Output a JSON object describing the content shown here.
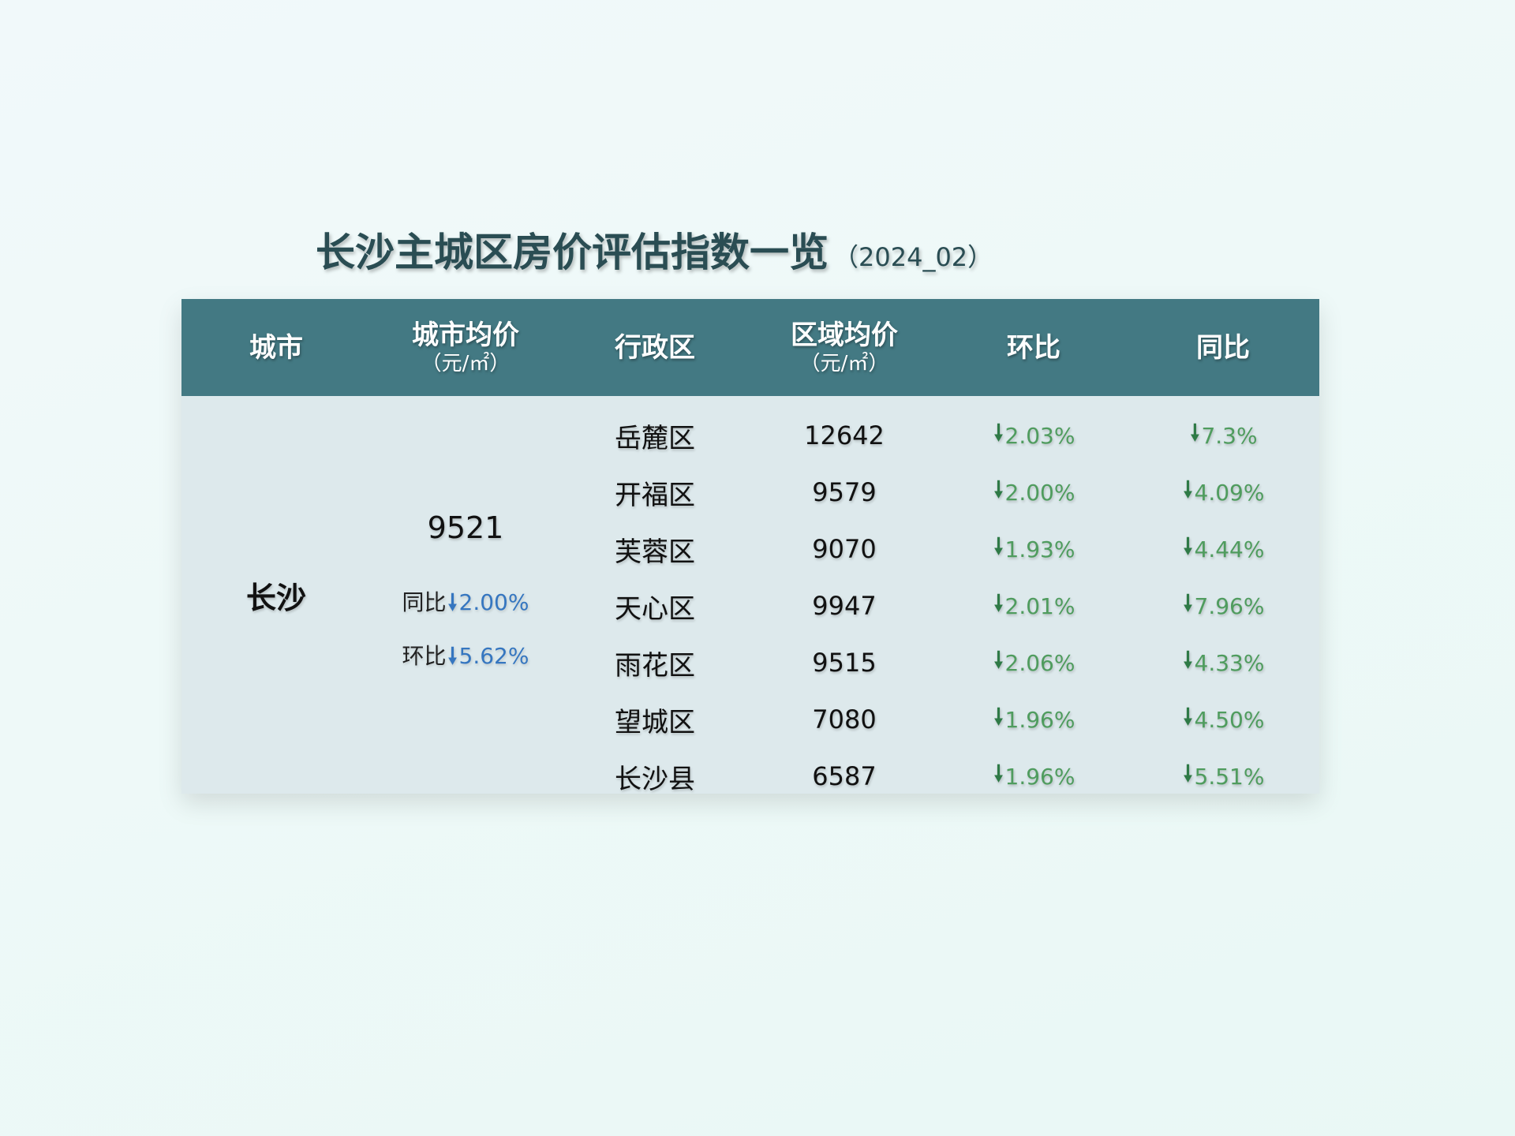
{
  "title": "长沙主城区房价评估指数一览",
  "title_suffix": "（2024_02）",
  "headers": {
    "city": "城市",
    "city_avg": "城市均价",
    "city_avg_unit": "（元/㎡）",
    "district": "行政区",
    "district_avg": "区域均价",
    "district_avg_unit": "（元/㎡）",
    "mom": "环比",
    "yoy": "同比"
  },
  "city": {
    "name": "长沙",
    "avg_price": "9521",
    "yoy_label": "同比",
    "yoy_value": "2.00%",
    "mom_label": "环比",
    "mom_value": "5.62%"
  },
  "down_arrow": "🠗",
  "colors": {
    "header_bg": "#437983",
    "body_bg": "#dde9ec",
    "title": "#2a4d53",
    "change_green": "#4f9c5e",
    "change_blue": "#3576c0"
  },
  "chart_data": {
    "type": "table",
    "title": "长沙主城区房价评估指数一览（2024_02）",
    "columns": [
      "城市",
      "城市均价（元/㎡）",
      "行政区",
      "区域均价（元/㎡）",
      "环比",
      "同比"
    ],
    "rows": [
      {
        "district": "岳麓区",
        "price": "12642",
        "mom": "2.03%",
        "yoy": "7.3%"
      },
      {
        "district": "开福区",
        "price": "9579",
        "mom": "2.00%",
        "yoy": "4.09%"
      },
      {
        "district": "芙蓉区",
        "price": "9070",
        "mom": "1.93%",
        "yoy": "4.44%"
      },
      {
        "district": "天心区",
        "price": "9947",
        "mom": "2.01%",
        "yoy": "7.96%"
      },
      {
        "district": "雨花区",
        "price": "9515",
        "mom": "2.06%",
        "yoy": "4.33%"
      },
      {
        "district": "望城区",
        "price": "7080",
        "mom": "1.96%",
        "yoy": "4.50%"
      },
      {
        "district": "长沙县",
        "price": "6587",
        "mom": "1.96%",
        "yoy": "5.51%"
      }
    ]
  }
}
